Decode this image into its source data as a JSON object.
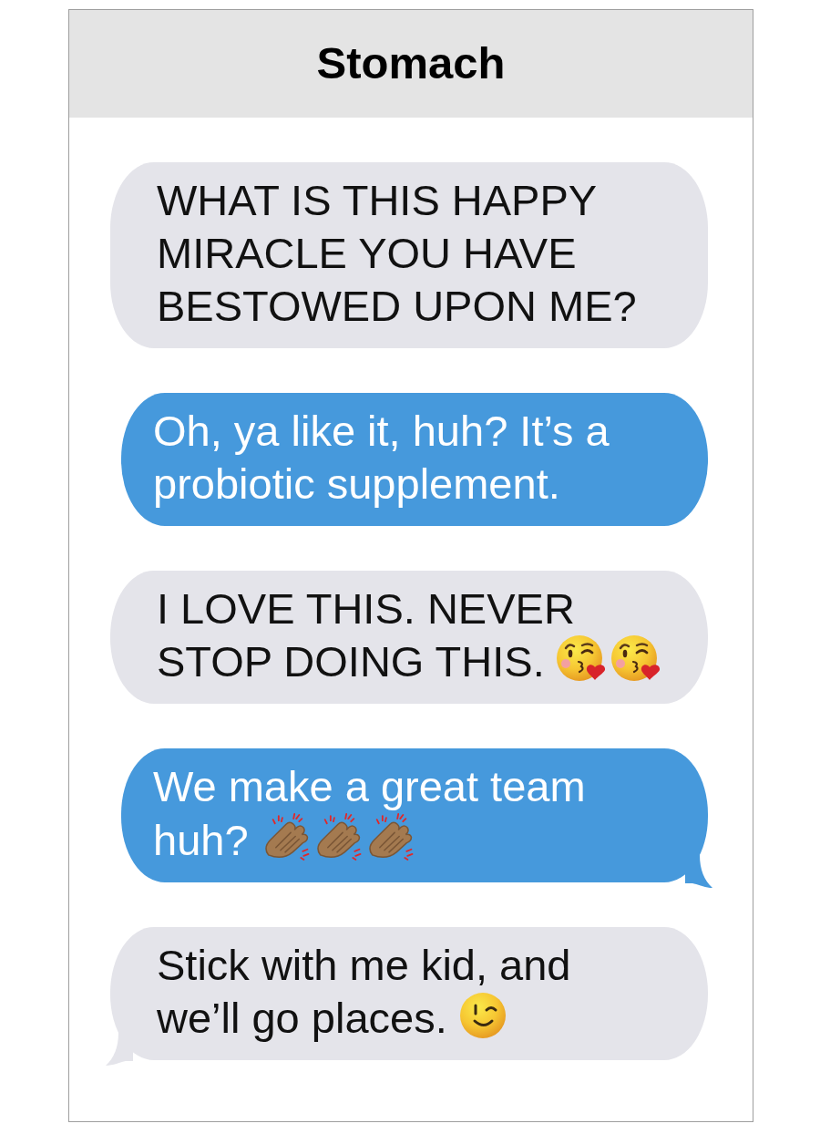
{
  "header": {
    "title": "Stomach"
  },
  "messages": [
    {
      "kind": "incoming",
      "lines": [
        "WHAT IS THIS HAPPY",
        "MIRACLE YOU HAVE",
        "BESTOWED UPON ME?"
      ],
      "tail": false
    },
    {
      "kind": "outgoing",
      "lines": [
        "Oh, ya like it, huh? It’s a",
        "probiotic supplement."
      ],
      "tail": false
    },
    {
      "kind": "incoming",
      "lines": [
        "I LOVE THIS. NEVER",
        "STOP DOING THIS."
      ],
      "emojis": [
        {
          "kind": "kiss"
        },
        {
          "kind": "kiss"
        }
      ],
      "tail": false
    },
    {
      "kind": "outgoing",
      "lines": [
        "We make a great team",
        "huh?"
      ],
      "emojis": [
        {
          "kind": "clap"
        },
        {
          "kind": "clap"
        },
        {
          "kind": "clap"
        }
      ],
      "tail": true
    },
    {
      "kind": "incoming",
      "lines": [
        "Stick with me kid, and",
        "we’ll go places."
      ],
      "emojis": [
        {
          "kind": "wink"
        }
      ],
      "tail": true
    }
  ]
}
